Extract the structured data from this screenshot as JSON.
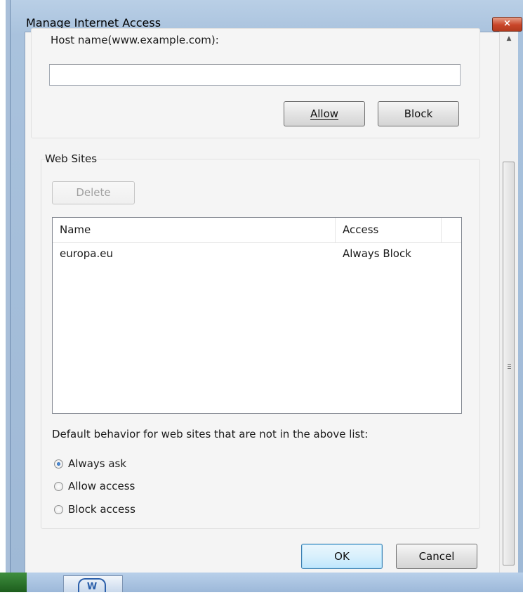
{
  "window": {
    "title": "Manage Internet Access",
    "close_glyph": "×"
  },
  "host_section": {
    "label": "Host name(www.example.com):",
    "input_value": "",
    "allow_label": "Allow",
    "block_label": "Block"
  },
  "websites": {
    "group_label": "Web Sites",
    "delete_label": "Delete",
    "columns": [
      "Name",
      "Access"
    ],
    "rows": [
      {
        "name": "europa.eu",
        "access": "Always Block"
      }
    ]
  },
  "default_behavior": {
    "label": "Default behavior for web sites that are not in the above list:",
    "options": [
      {
        "label": "Always ask",
        "checked": true
      },
      {
        "label": "Allow access",
        "checked": false
      },
      {
        "label": "Block access",
        "checked": false
      }
    ]
  },
  "footer": {
    "ok_label": "OK",
    "cancel_label": "Cancel"
  },
  "taskbar": {
    "word_icon_text": "W"
  },
  "colors": {
    "frame": "#a9c2dd",
    "close_button": "#c9462a",
    "default_button_border": "#3c7fb1"
  }
}
